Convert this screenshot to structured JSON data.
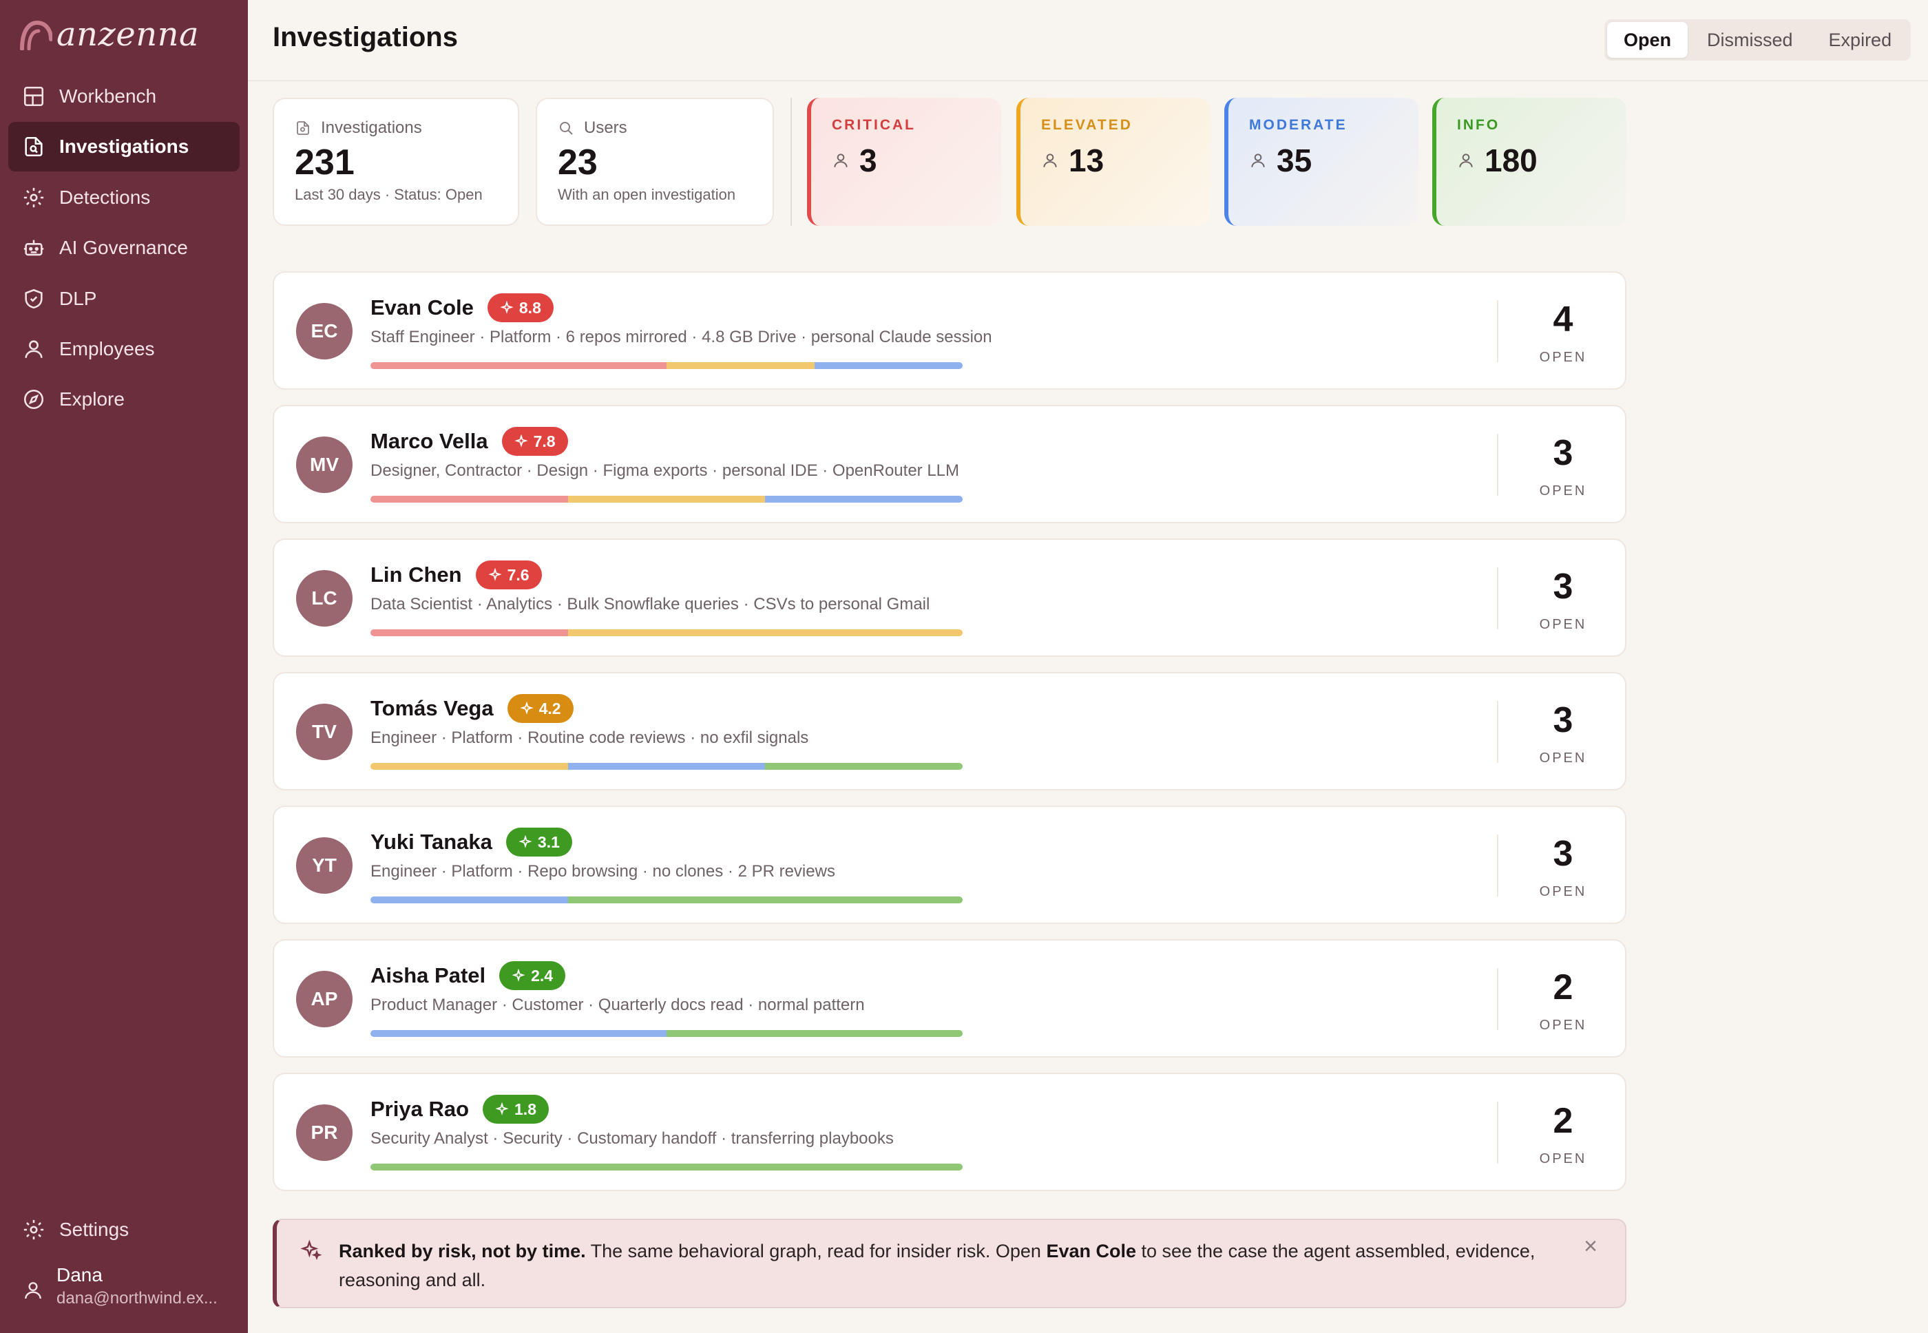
{
  "app": {
    "logo_text": "anzenna"
  },
  "sidebar": {
    "items": [
      {
        "label": "Workbench",
        "icon": "layout-icon"
      },
      {
        "label": "Investigations",
        "icon": "file-search-icon",
        "active": true
      },
      {
        "label": "Detections",
        "icon": "radar-icon"
      },
      {
        "label": "AI Governance",
        "icon": "robot-icon"
      },
      {
        "label": "DLP",
        "icon": "shield-icon"
      },
      {
        "label": "Employees",
        "icon": "user-icon"
      },
      {
        "label": "Explore",
        "icon": "compass-icon"
      }
    ],
    "settings_label": "Settings",
    "user": {
      "name": "Dana",
      "email": "dana@northwind.ex..."
    }
  },
  "header": {
    "title": "Investigations",
    "tabs": [
      "Open",
      "Dismissed",
      "Expired"
    ],
    "active_tab": "Open"
  },
  "stats": {
    "investigations": {
      "label": "Investigations",
      "value": "231",
      "sub": "Last 30 days · Status: Open"
    },
    "users": {
      "label": "Users",
      "value": "23",
      "sub": "With an open investigation"
    }
  },
  "severity": {
    "critical": {
      "label": "CRITICAL",
      "value": "3",
      "color": "#e04b4b"
    },
    "elevated": {
      "label": "ELEVATED",
      "value": "13",
      "color": "#eea71f"
    },
    "moderate": {
      "label": "MODERATE",
      "value": "35",
      "color": "#4b83e6"
    },
    "info": {
      "label": "INFO",
      "value": "180",
      "color": "#47a52a"
    }
  },
  "rows": [
    {
      "initials": "EC",
      "name": "Evan Cole",
      "score": "8.8",
      "level": "red",
      "meta": "Staff Engineer · Platform  ·  6 repos mirrored · 4.8 GB Drive · personal Claude session",
      "count": "4",
      "count_label": "OPEN",
      "bar": [
        [
          "red",
          0.5
        ],
        [
          "amber",
          0.25
        ],
        [
          "blue",
          0.25
        ]
      ]
    },
    {
      "initials": "MV",
      "name": "Marco Vella",
      "score": "7.8",
      "level": "red",
      "meta": "Designer, Contractor · Design  ·  Figma exports · personal IDE · OpenRouter LLM",
      "count": "3",
      "count_label": "OPEN",
      "bar": [
        [
          "red",
          0.3333
        ],
        [
          "amber",
          0.3333
        ],
        [
          "blue",
          0.3334
        ]
      ]
    },
    {
      "initials": "LC",
      "name": "Lin Chen",
      "score": "7.6",
      "level": "red",
      "meta": "Data Scientist · Analytics  ·  Bulk Snowflake queries · CSVs to personal Gmail",
      "count": "3",
      "count_label": "OPEN",
      "bar": [
        [
          "red",
          0.3333
        ],
        [
          "amber",
          0.6667
        ]
      ]
    },
    {
      "initials": "TV",
      "name": "Tomás Vega",
      "score": "4.2",
      "level": "amber",
      "meta": "Engineer · Platform  ·  Routine code reviews · no exfil signals",
      "count": "3",
      "count_label": "OPEN",
      "bar": [
        [
          "amber",
          0.3333
        ],
        [
          "blue",
          0.3333
        ],
        [
          "green",
          0.3334
        ]
      ]
    },
    {
      "initials": "YT",
      "name": "Yuki Tanaka",
      "score": "3.1",
      "level": "green",
      "meta": "Engineer · Platform  ·  Repo browsing · no clones · 2 PR reviews",
      "count": "3",
      "count_label": "OPEN",
      "bar": [
        [
          "blue",
          0.3333
        ],
        [
          "green",
          0.6667
        ]
      ]
    },
    {
      "initials": "AP",
      "name": "Aisha Patel",
      "score": "2.4",
      "level": "green",
      "meta": "Product Manager · Customer  ·  Quarterly docs read · normal pattern",
      "count": "2",
      "count_label": "OPEN",
      "bar": [
        [
          "blue",
          0.5
        ],
        [
          "green",
          0.5
        ]
      ]
    },
    {
      "initials": "PR",
      "name": "Priya Rao",
      "score": "1.8",
      "level": "green",
      "meta": "Security Analyst · Security  ·  Customary handoff · transferring playbooks",
      "count": "2",
      "count_label": "OPEN",
      "bar": [
        [
          "green",
          1.0
        ]
      ]
    }
  ],
  "callout": {
    "lead": "Ranked by risk, not by time.",
    "text1": " The same behavioral graph, read for insider risk. Open ",
    "name": "Evan Cole",
    "text2": " to see the case the agent assembled, evidence, reasoning and all.",
    "close": "×"
  }
}
